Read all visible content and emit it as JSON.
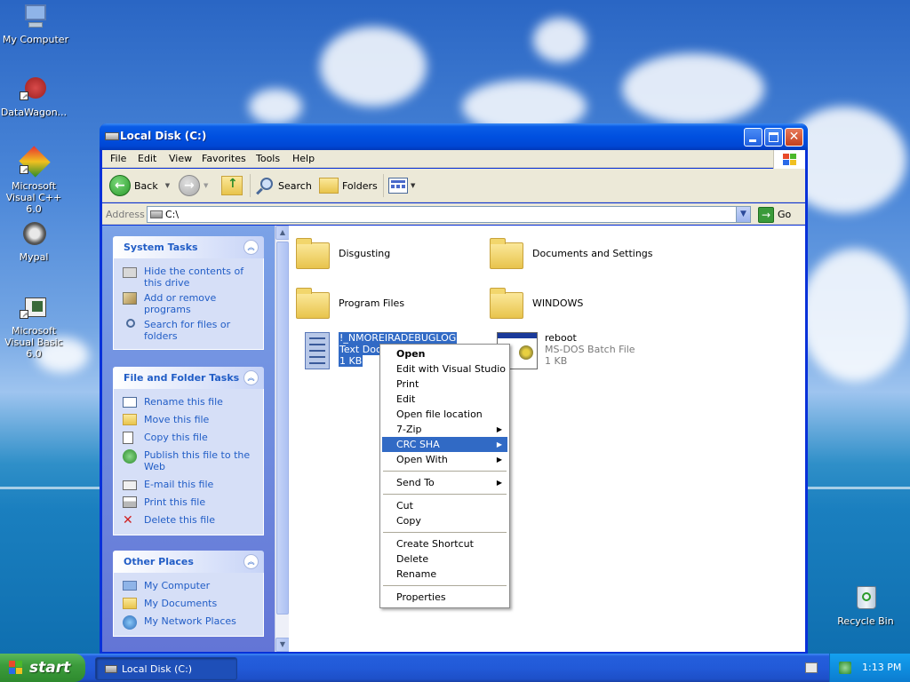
{
  "desktop": {
    "icons": [
      {
        "label": "My Computer"
      },
      {
        "label": "DataWagon..."
      },
      {
        "label": "Microsoft Visual C++ 6.0"
      },
      {
        "label": "Mypal"
      },
      {
        "label": "Microsoft Visual Basic 6.0"
      },
      {
        "label": "Recycle Bin"
      }
    ]
  },
  "window": {
    "title": "Local Disk (C:)",
    "menu": [
      "File",
      "Edit",
      "View",
      "Favorites",
      "Tools",
      "Help"
    ],
    "toolbar": {
      "back": "Back",
      "search": "Search",
      "folders": "Folders"
    },
    "address": {
      "label": "Address",
      "value": "C:\\",
      "go": "Go"
    }
  },
  "left_pane": {
    "system_tasks": {
      "title": "System Tasks",
      "items": [
        "Hide the contents of this drive",
        "Add or remove programs",
        "Search for files or folders"
      ]
    },
    "file_folder_tasks": {
      "title": "File and Folder Tasks",
      "items": [
        "Rename this file",
        "Move this file",
        "Copy this file",
        "Publish this file to the Web",
        "E-mail this file",
        "Print this file",
        "Delete this file"
      ]
    },
    "other_places": {
      "title": "Other Places",
      "items": [
        "My Computer",
        "My Documents",
        "My Network Places"
      ]
    }
  },
  "content": {
    "items": [
      {
        "name": "Disgusting"
      },
      {
        "name": "Documents and Settings"
      },
      {
        "name": "Program Files"
      },
      {
        "name": "WINDOWS"
      },
      {
        "name": "!_NMOREIRADEBUGLOG",
        "type": "Text Doc",
        "size": "1 KB"
      },
      {
        "name": "reboot",
        "type": "MS-DOS Batch File",
        "size": "1 KB"
      }
    ]
  },
  "context_menu": {
    "items": [
      "Open",
      "Edit with Visual Studio",
      "Print",
      "Edit",
      "Open file location",
      "7-Zip",
      "CRC SHA",
      "Open With",
      "Send To",
      "Cut",
      "Copy",
      "Create Shortcut",
      "Delete",
      "Rename",
      "Properties"
    ],
    "highlighted": "CRC SHA"
  },
  "taskbar": {
    "start": "start",
    "task": "Local Disk (C:)",
    "clock": "1:13 PM"
  },
  "colors": {
    "title_blue": "#0050e0",
    "selection": "#316ac5",
    "task_link": "#215dc6",
    "start_green": "#3c9c3c"
  }
}
